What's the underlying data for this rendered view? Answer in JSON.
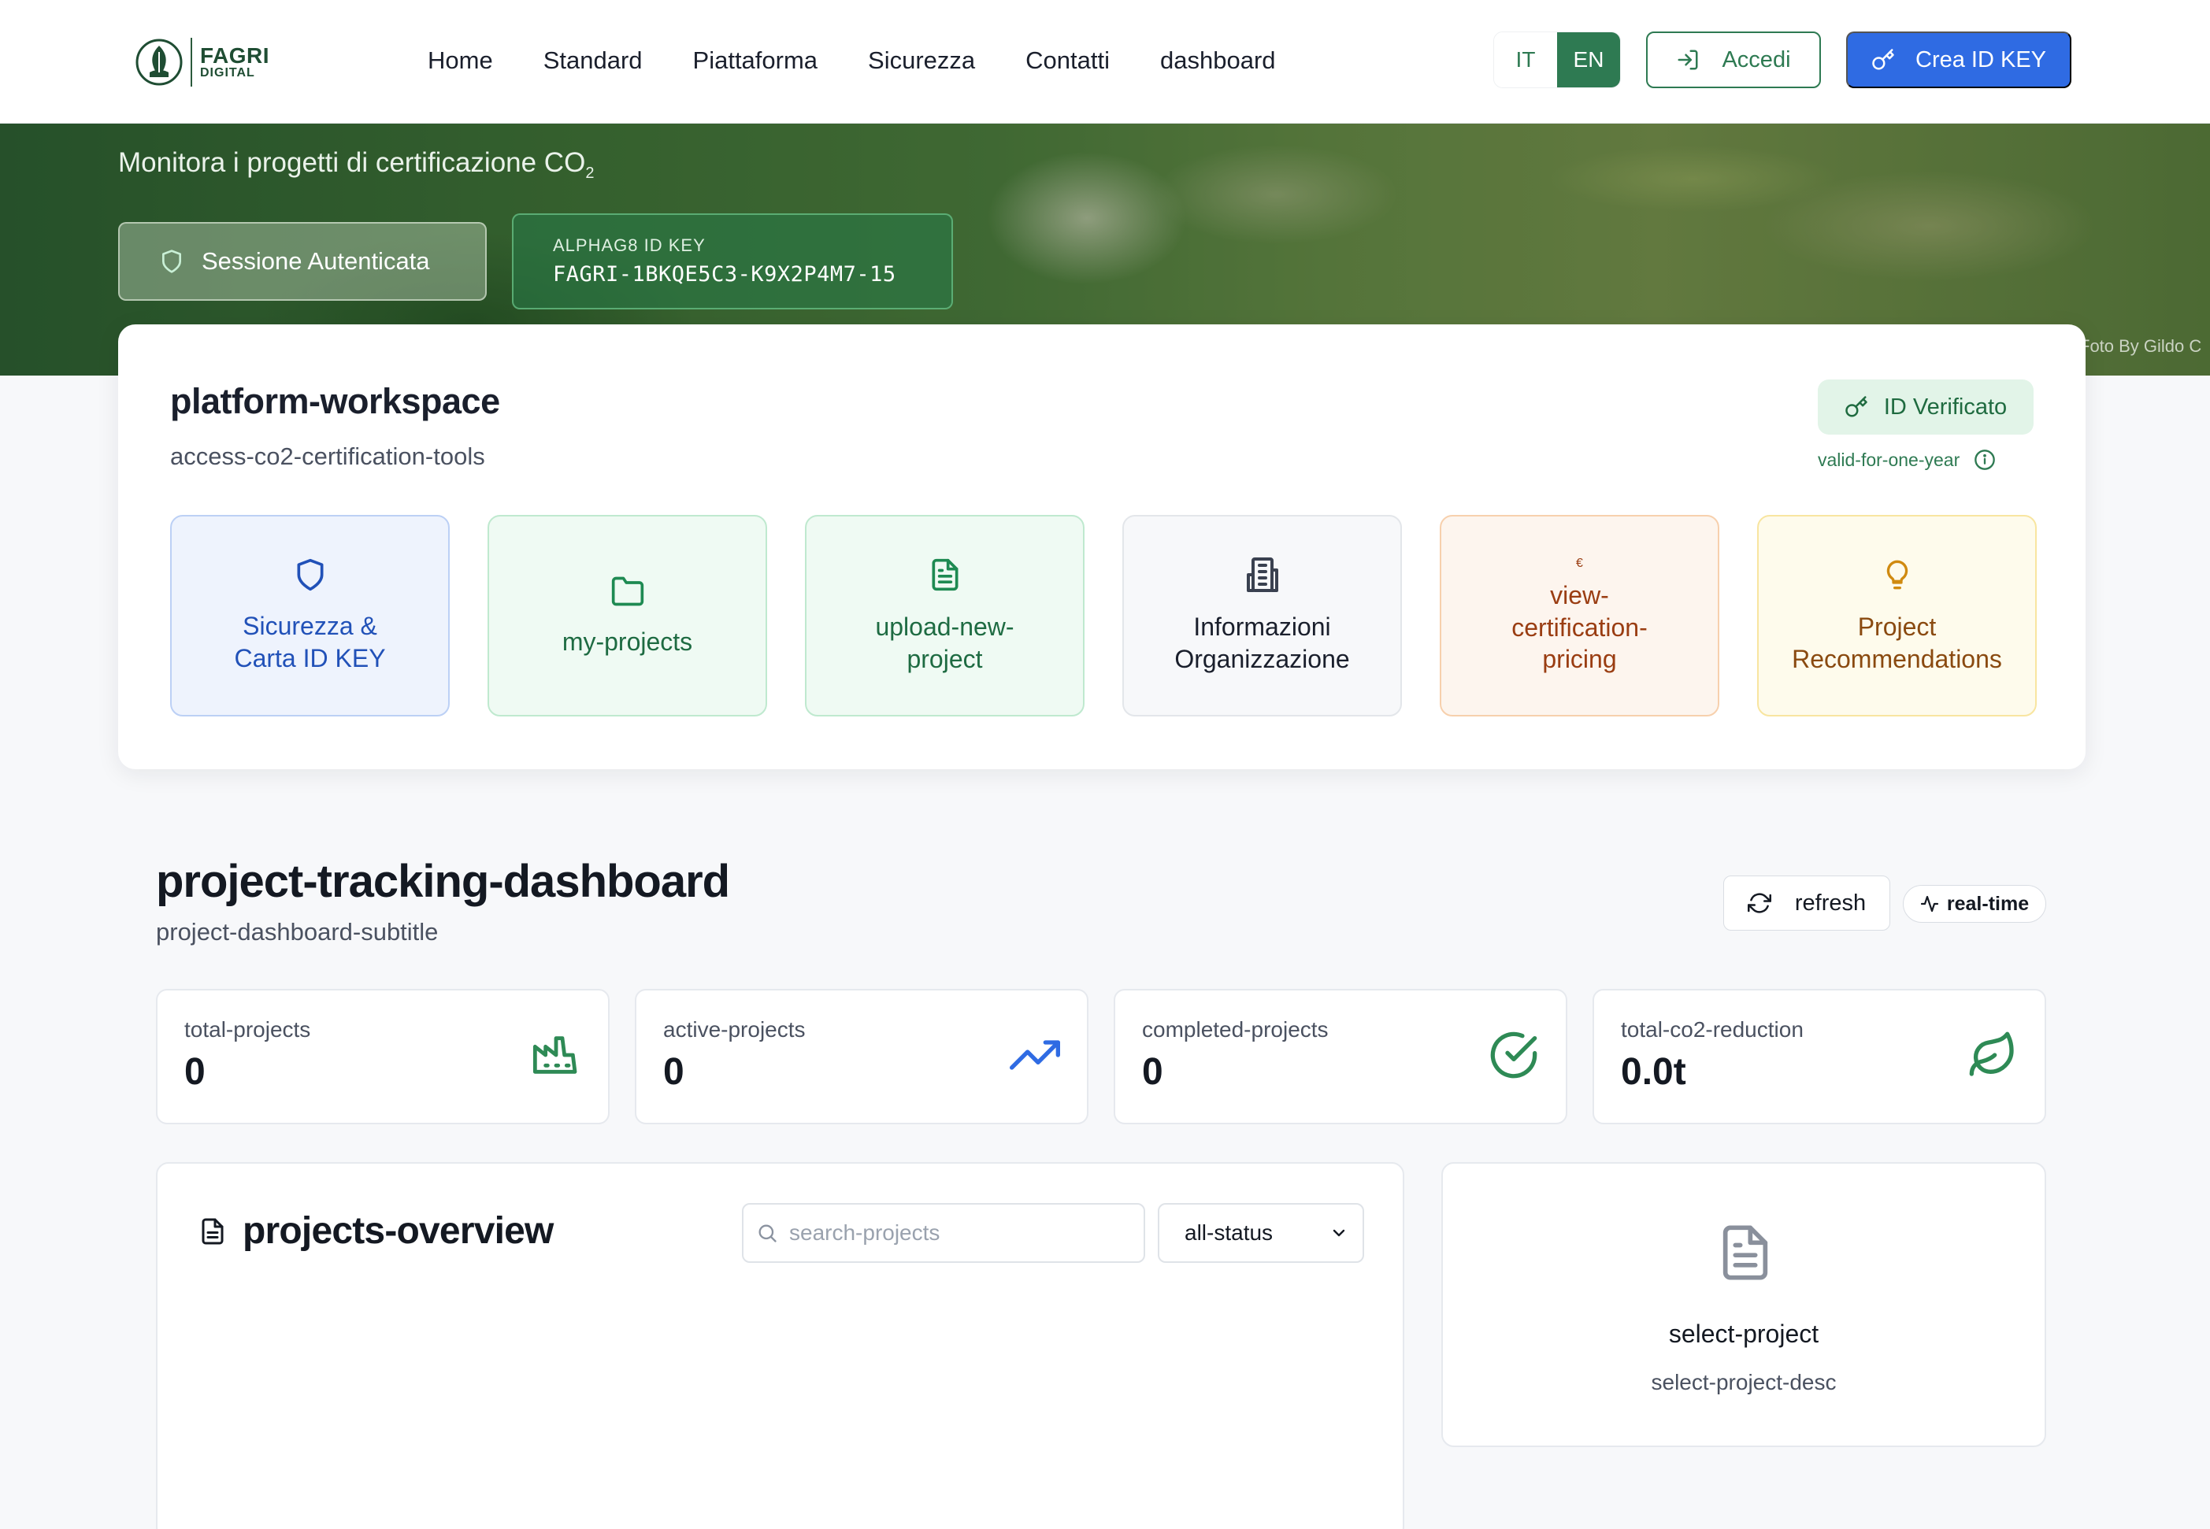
{
  "brand": {
    "line1": "FAGRI",
    "line2": "DIGITAL"
  },
  "nav": {
    "links": [
      "Home",
      "Standard",
      "Piattaforma",
      "Sicurezza",
      "Contatti",
      "dashboard"
    ]
  },
  "lang": {
    "it": "IT",
    "en": "EN",
    "active": "EN"
  },
  "header_buttons": {
    "login": "Accedi",
    "create": "Crea ID KEY"
  },
  "hero": {
    "title": "Monitora i progetti di certificazione CO",
    "title_sub": "2",
    "session_label": "Sessione Autenticata",
    "idkey_label": "ALPHAG8 ID KEY",
    "idkey_value": "FAGRI-1BKQE5C3-K9X2P4M7-15",
    "photo_credit": "Foto By Gildo C"
  },
  "workspace": {
    "title": "platform-workspace",
    "subtitle": "access-co2-certification-tools",
    "verified_badge": "ID Verificato",
    "valid_text": "valid-for-one-year",
    "tiles": [
      {
        "label": "Sicurezza & Carta ID KEY",
        "icon": "shield-icon"
      },
      {
        "label": "my-projects",
        "icon": "folder-icon"
      },
      {
        "label": "upload-new-project",
        "icon": "file-text-icon"
      },
      {
        "label": "Informazioni Organizzazione",
        "icon": "building-icon"
      },
      {
        "label": "view-certification-pricing",
        "icon": "euro-icon",
        "glyph": "€"
      },
      {
        "label": "Project Recommendations",
        "icon": "lightbulb-icon"
      }
    ]
  },
  "dashboard": {
    "title": "project-tracking-dashboard",
    "subtitle": "project-dashboard-subtitle",
    "refresh_label": "refresh",
    "realtime_label": "real-time",
    "stats": [
      {
        "label": "total-projects",
        "value": "0",
        "icon": "factory-icon"
      },
      {
        "label": "active-projects",
        "value": "0",
        "icon": "trending-up-icon"
      },
      {
        "label": "completed-projects",
        "value": "0",
        "icon": "check-circle-icon"
      },
      {
        "label": "total-co2-reduction",
        "value": "0.0t",
        "icon": "leaf-icon"
      }
    ],
    "projects": {
      "title": "projects-overview",
      "search_placeholder": "search-projects",
      "status_selected": "all-status"
    },
    "select_project": {
      "title": "select-project",
      "desc": "select-project-desc"
    }
  },
  "colors": {
    "brand_green": "#2e7a52",
    "primary_blue": "#2f6be3",
    "text_dark": "#141922"
  }
}
